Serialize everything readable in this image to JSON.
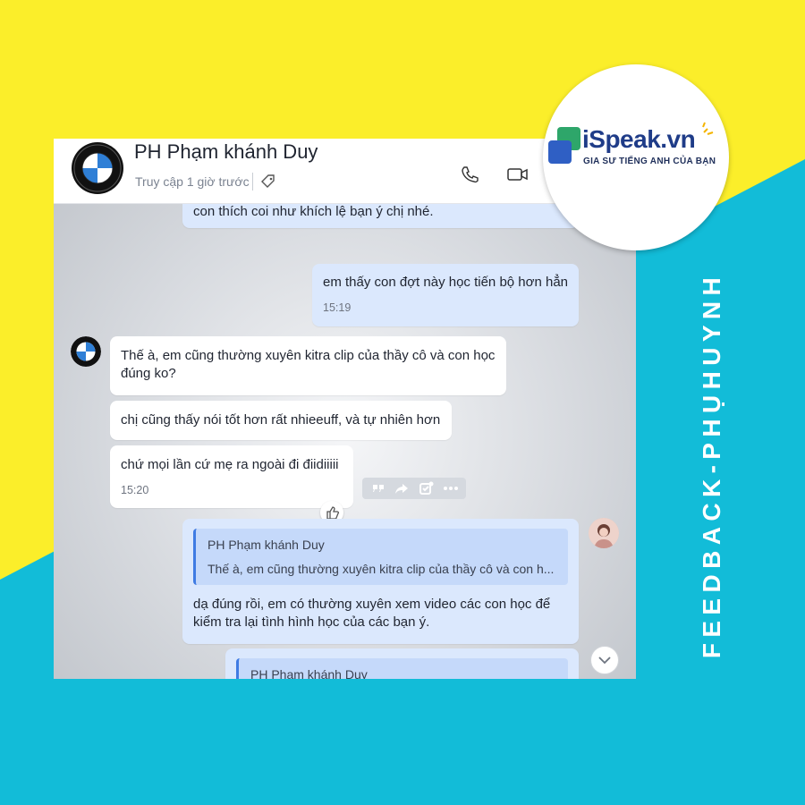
{
  "colors": {
    "background_yellow": "#fbee2a",
    "background_cyan": "#12bcd8",
    "bubble_outgoing": "#dbe8fd",
    "bubble_incoming": "#ffffff",
    "quote_bar": "#3f7be3",
    "brand_blue": "#1f3c88"
  },
  "header": {
    "name": "PH Phạm khánh Duy",
    "status": "Truy cập 1 giờ trước",
    "icons": [
      "bmw-avatar",
      "tag-icon",
      "phone-icon",
      "video-call-icon"
    ]
  },
  "messages": [
    {
      "side": "out",
      "text": "bạn ý là con trai nào nên nhiều khi phải nghiêm khắc hơn, còn hcoj tiến bộ mình thỉnh thoiangr thưởng cho bạn đồ gì đó mà con thích coi như khích lệ bạn ý chị nhé."
    },
    {
      "side": "out",
      "text": "em thấy con đợt này học tiến bộ hơn hẳn",
      "time": "15:19"
    },
    {
      "side": "in",
      "text": "Thế à, em cũng thường xuyên kitra clip của thầy cô và con học đúng ko?"
    },
    {
      "side": "in",
      "text": "chị cũng thấy nói tốt hơn rất nhieeuff, và tự nhiên hơn"
    },
    {
      "side": "in",
      "text": "chứ mọi lần cứ mẹ ra ngoài đi điidiiiii",
      "time": "15:20"
    },
    {
      "side": "out",
      "quote": {
        "name": "PH Phạm khánh Duy",
        "text": "Thế à, em cũng thường xuyên kitra clip của thầy cô và con h..."
      },
      "text": "dạ đúng rồi, em có thường xuyên xem video các con học để kiểm tra lại tình hình học của các bạn ý."
    },
    {
      "side": "out",
      "quote": {
        "name": "PH Phạm khánh Duy"
      }
    }
  ],
  "message_tools": [
    "quote-icon",
    "share-icon",
    "mark-task-icon",
    "more-icon"
  ],
  "logo": {
    "brand": "iSpeak.vn",
    "tagline": "GIA SƯ TIẾNG ANH CỦA BẠN"
  },
  "side_label": "FEEDBACK-PHỤHUYNH"
}
